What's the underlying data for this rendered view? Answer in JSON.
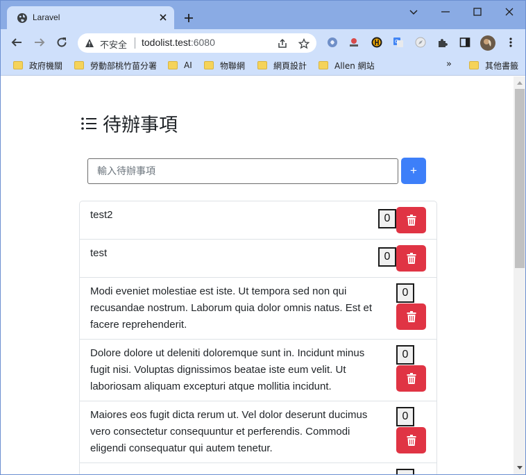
{
  "browser": {
    "tab_title": "Laravel",
    "security_label": "不安全",
    "url_host": "todolist.test",
    "url_port": ":6080",
    "bookmarks": [
      "政府機關",
      "勞動部桃竹苗分署",
      "AI",
      "物聯網",
      "網頁設計",
      "Allen 網站"
    ],
    "bookmarks_more": "»",
    "other_bookmarks": "其他書籤"
  },
  "page": {
    "heading": "待辦事項",
    "input_placeholder": "輸入待辦事項",
    "add_label": "+",
    "todos": [
      {
        "text": "test2",
        "count": "0"
      },
      {
        "text": "test",
        "count": "0"
      },
      {
        "lines": [
          "Modi eveniet molestiae est iste. Ut tempora sed non qui",
          "recusandae nostrum. Laborum quia dolor omnis natus. Est et",
          "facere reprehenderit."
        ],
        "count": "0"
      },
      {
        "lines": [
          "Dolore dolore ut deleniti doloremque sunt in. Incidunt minus",
          "fugit nisi. Voluptas dignissimos beatae iste eum velit. Ut",
          "laboriosam aliquam excepturi atque mollitia incidunt."
        ],
        "count": "0"
      },
      {
        "lines": [
          "Maiores eos fugit dicta rerum ut. Vel dolor deserunt ducimus",
          "vero consectetur consequuntur et perferendis. Commodi",
          "eligendi consequatur qui autem tenetur."
        ],
        "count": "0"
      }
    ]
  },
  "colors": {
    "primary": "#3d7ff9",
    "danger": "#e03444",
    "tabstrip": "#8aabe4",
    "toolbar": "#cfe0fb"
  }
}
